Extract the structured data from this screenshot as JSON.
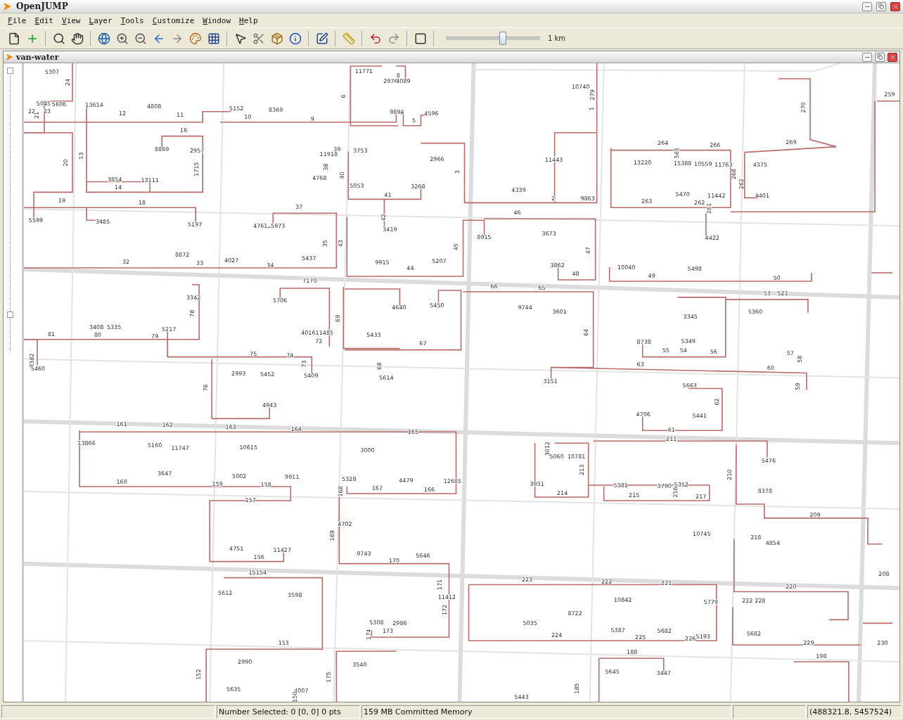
{
  "window": {
    "title": "OpenJUMP"
  },
  "menu": [
    "File",
    "Edit",
    "View",
    "Layer",
    "Tools",
    "Customize",
    "Window",
    "Help"
  ],
  "toolbar": {
    "zoom_slider": {
      "level": 0.6
    },
    "scale": "1 km"
  },
  "layer_window": {
    "title": "van-water"
  },
  "map": {
    "labels": [
      "5307",
      "24",
      "5045",
      "5606",
      "22",
      "23",
      "21",
      "13614",
      "12",
      "4808",
      "11",
      "5152",
      "10",
      "8369",
      "9",
      "11771",
      "6",
      "2976",
      "4089",
      "8",
      "9894",
      "5",
      "4596",
      "10740",
      "279",
      "1",
      "270",
      "259",
      "16",
      "8869",
      "2957",
      "1715",
      "13",
      "20",
      "3854",
      "14",
      "13111",
      "19",
      "18",
      "5599",
      "3485",
      "5197",
      "39",
      "11918",
      "3753",
      "38",
      "40",
      "4768",
      "5053",
      "41",
      "3268",
      "2966",
      "3",
      "11443",
      "4339",
      "2",
      "9863",
      "264",
      "266",
      "13220",
      "15388",
      "565",
      "10559",
      "11763",
      "268",
      "262",
      "4375",
      "269",
      "5470",
      "11442",
      "263",
      "262",
      "261",
      "4401",
      "4422",
      "37",
      "4761",
      "5973",
      "42",
      "3419",
      "43",
      "35",
      "45",
      "46",
      "8915",
      "3673",
      "47",
      "8872",
      "32",
      "33",
      "4027",
      "34",
      "5437",
      "9915",
      "44",
      "5207",
      "3862",
      "48",
      "10040",
      "49",
      "5498",
      "50",
      "7170",
      "66",
      "65",
      "3342",
      "78",
      "5706",
      "4640",
      "5450",
      "9744",
      "3601",
      "53",
      "521",
      "3345",
      "5360",
      "69",
      "64",
      "3408",
      "5335",
      "81",
      "80",
      "5217",
      "79",
      "4016",
      "11485",
      "72",
      "5433",
      "67",
      "8738",
      "5349",
      "55",
      "54",
      "56",
      "57",
      "58",
      "8382",
      "5460",
      "75",
      "74",
      "73",
      "2993",
      "5452",
      "5409",
      "68",
      "5614",
      "63",
      "60",
      "3151",
      "5663",
      "59",
      "76",
      "4943",
      "62",
      "4706",
      "5441",
      "161",
      "162",
      "163",
      "164",
      "165",
      "61",
      "211",
      "13866",
      "5160",
      "11747",
      "10615",
      "3000",
      "3012",
      "5060",
      "10781",
      "213",
      "5476",
      "210",
      "3647",
      "5002",
      "9911",
      "160",
      "159",
      "158",
      "5328",
      "4479",
      "12685",
      "167",
      "166",
      "168",
      "3931",
      "214",
      "5381",
      "3790",
      "5352",
      "216",
      "215",
      "217",
      "8378",
      "157",
      "209",
      "4702",
      "169",
      "10745",
      "218",
      "4854",
      "4751",
      "11427",
      "156",
      "9743",
      "5646",
      "170",
      "15154",
      "208",
      "223",
      "222",
      "221",
      "220",
      "5612",
      "3598",
      "171",
      "11412",
      "172",
      "10842",
      "5779",
      "222",
      "228",
      "8722",
      "5308",
      "2986",
      "5035",
      "173",
      "174",
      "5387",
      "5682",
      "5682",
      "224",
      "225",
      "226",
      "5193",
      "153",
      "229",
      "230",
      "2990",
      "3540",
      "188",
      "198",
      "5645",
      "3447",
      "152",
      "175",
      "185",
      "5635",
      "4007",
      "150",
      "5443"
    ]
  },
  "status_bar": {
    "cells": [
      "Number Selected: 0 [0, 0] 0 pts",
      "159 MB Committed Memory",
      "(488321.8, 5457524)"
    ]
  }
}
